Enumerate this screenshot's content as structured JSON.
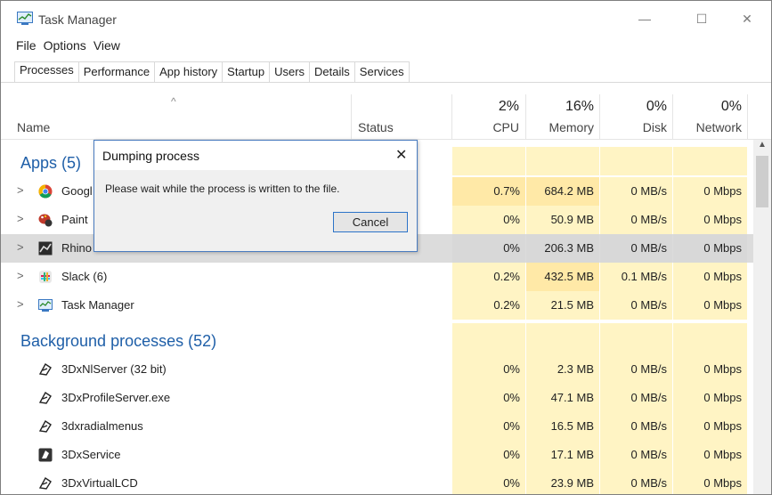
{
  "window": {
    "title": "Task Manager",
    "min_glyph": "—",
    "max_glyph": "☐",
    "close_glyph": "✕"
  },
  "menu": [
    "File",
    "Options",
    "View"
  ],
  "tabs": [
    "Processes",
    "Performance",
    "App history",
    "Startup",
    "Users",
    "Details",
    "Services"
  ],
  "header": {
    "sort_glyph": "^",
    "name": "Name",
    "status": "Status",
    "cpu_pct": "2%",
    "cpu": "CPU",
    "mem_pct": "16%",
    "mem": "Memory",
    "disk_pct": "0%",
    "disk": "Disk",
    "net_pct": "0%",
    "net": "Network"
  },
  "groups": {
    "apps": "Apps (5)",
    "background": "Background processes (52)"
  },
  "apps": [
    {
      "name": "Googl",
      "cpu": "0.7%",
      "mem": "684.2 MB",
      "disk": "0 MB/s",
      "net": "0 Mbps",
      "icon": "chrome-icon"
    },
    {
      "name": "Paint",
      "cpu": "0%",
      "mem": "50.9 MB",
      "disk": "0 MB/s",
      "net": "0 Mbps",
      "icon": "paint-icon"
    },
    {
      "name": "Rhino",
      "cpu": "0%",
      "mem": "206.3 MB",
      "disk": "0 MB/s",
      "net": "0 Mbps",
      "icon": "rhino-icon"
    },
    {
      "name": "Slack (6)",
      "cpu": "0.2%",
      "mem": "432.5 MB",
      "disk": "0.1 MB/s",
      "net": "0 Mbps",
      "icon": "slack-icon"
    },
    {
      "name": "Task Manager",
      "cpu": "0.2%",
      "mem": "21.5 MB",
      "disk": "0 MB/s",
      "net": "0 Mbps",
      "icon": "task-manager-icon"
    }
  ],
  "background": [
    {
      "name": "3DxNlServer (32 bit)",
      "cpu": "0%",
      "mem": "2.3 MB",
      "disk": "0 MB/s",
      "net": "0 Mbps",
      "icon": "3dx-icon"
    },
    {
      "name": "3DxProfileServer.exe",
      "cpu": "0%",
      "mem": "47.1 MB",
      "disk": "0 MB/s",
      "net": "0 Mbps",
      "icon": "3dx-icon"
    },
    {
      "name": "3dxradialmenus",
      "cpu": "0%",
      "mem": "16.5 MB",
      "disk": "0 MB/s",
      "net": "0 Mbps",
      "icon": "3dx-icon"
    },
    {
      "name": "3DxService",
      "cpu": "0%",
      "mem": "17.1 MB",
      "disk": "0 MB/s",
      "net": "0 Mbps",
      "icon": "3dx-service-icon"
    },
    {
      "name": "3DxVirtualLCD",
      "cpu": "0%",
      "mem": "23.9 MB",
      "disk": "0 MB/s",
      "net": "0 Mbps",
      "icon": "3dx-icon"
    }
  ],
  "dialog": {
    "title": "Dumping process",
    "close_glyph": "✕",
    "message": "Please wait while the process is written to the file.",
    "cancel": "Cancel"
  },
  "colors": {
    "accent": "#1f5fa8",
    "cell_light": "#fff4c4",
    "cell_med": "#ffe9a7",
    "highlight": "#dcdcdc"
  }
}
